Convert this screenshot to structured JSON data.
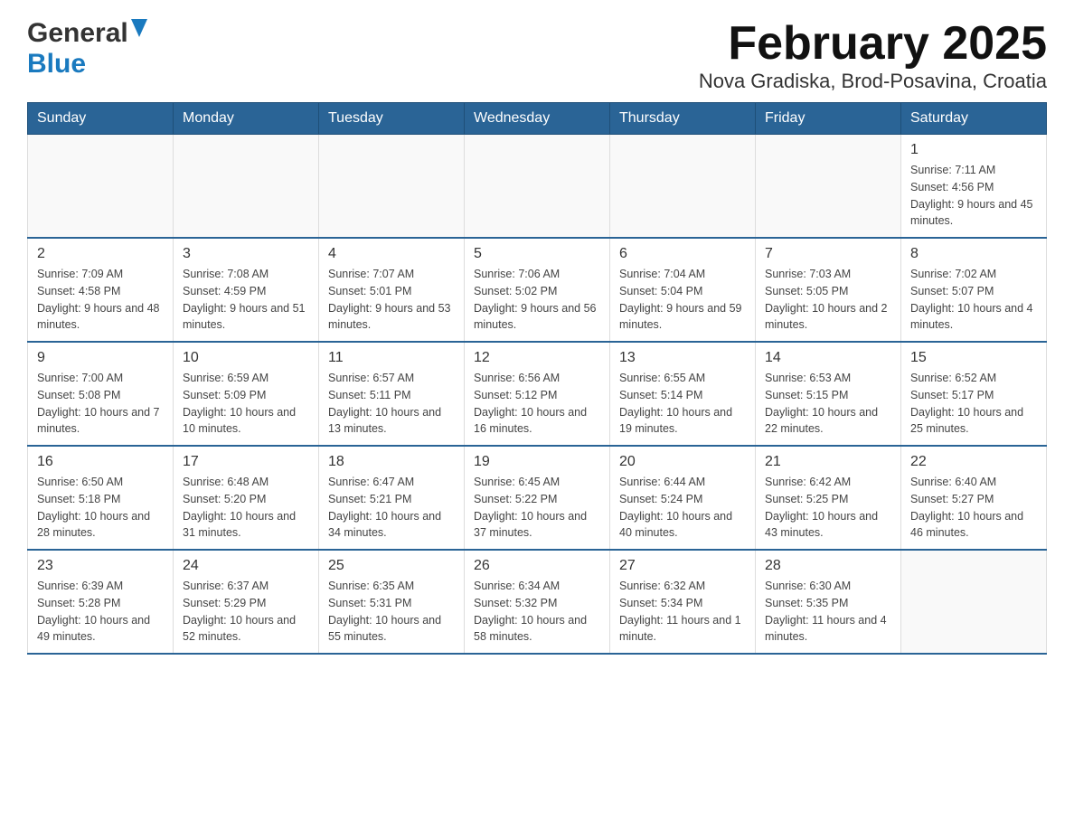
{
  "header": {
    "logo_general": "General",
    "logo_blue": "Blue",
    "title": "February 2025",
    "subtitle": "Nova Gradiska, Brod-Posavina, Croatia"
  },
  "days_of_week": [
    "Sunday",
    "Monday",
    "Tuesday",
    "Wednesday",
    "Thursday",
    "Friday",
    "Saturday"
  ],
  "weeks": [
    [
      {
        "day": "",
        "info": ""
      },
      {
        "day": "",
        "info": ""
      },
      {
        "day": "",
        "info": ""
      },
      {
        "day": "",
        "info": ""
      },
      {
        "day": "",
        "info": ""
      },
      {
        "day": "",
        "info": ""
      },
      {
        "day": "1",
        "info": "Sunrise: 7:11 AM\nSunset: 4:56 PM\nDaylight: 9 hours and 45 minutes."
      }
    ],
    [
      {
        "day": "2",
        "info": "Sunrise: 7:09 AM\nSunset: 4:58 PM\nDaylight: 9 hours and 48 minutes."
      },
      {
        "day": "3",
        "info": "Sunrise: 7:08 AM\nSunset: 4:59 PM\nDaylight: 9 hours and 51 minutes."
      },
      {
        "day": "4",
        "info": "Sunrise: 7:07 AM\nSunset: 5:01 PM\nDaylight: 9 hours and 53 minutes."
      },
      {
        "day": "5",
        "info": "Sunrise: 7:06 AM\nSunset: 5:02 PM\nDaylight: 9 hours and 56 minutes."
      },
      {
        "day": "6",
        "info": "Sunrise: 7:04 AM\nSunset: 5:04 PM\nDaylight: 9 hours and 59 minutes."
      },
      {
        "day": "7",
        "info": "Sunrise: 7:03 AM\nSunset: 5:05 PM\nDaylight: 10 hours and 2 minutes."
      },
      {
        "day": "8",
        "info": "Sunrise: 7:02 AM\nSunset: 5:07 PM\nDaylight: 10 hours and 4 minutes."
      }
    ],
    [
      {
        "day": "9",
        "info": "Sunrise: 7:00 AM\nSunset: 5:08 PM\nDaylight: 10 hours and 7 minutes."
      },
      {
        "day": "10",
        "info": "Sunrise: 6:59 AM\nSunset: 5:09 PM\nDaylight: 10 hours and 10 minutes."
      },
      {
        "day": "11",
        "info": "Sunrise: 6:57 AM\nSunset: 5:11 PM\nDaylight: 10 hours and 13 minutes."
      },
      {
        "day": "12",
        "info": "Sunrise: 6:56 AM\nSunset: 5:12 PM\nDaylight: 10 hours and 16 minutes."
      },
      {
        "day": "13",
        "info": "Sunrise: 6:55 AM\nSunset: 5:14 PM\nDaylight: 10 hours and 19 minutes."
      },
      {
        "day": "14",
        "info": "Sunrise: 6:53 AM\nSunset: 5:15 PM\nDaylight: 10 hours and 22 minutes."
      },
      {
        "day": "15",
        "info": "Sunrise: 6:52 AM\nSunset: 5:17 PM\nDaylight: 10 hours and 25 minutes."
      }
    ],
    [
      {
        "day": "16",
        "info": "Sunrise: 6:50 AM\nSunset: 5:18 PM\nDaylight: 10 hours and 28 minutes."
      },
      {
        "day": "17",
        "info": "Sunrise: 6:48 AM\nSunset: 5:20 PM\nDaylight: 10 hours and 31 minutes."
      },
      {
        "day": "18",
        "info": "Sunrise: 6:47 AM\nSunset: 5:21 PM\nDaylight: 10 hours and 34 minutes."
      },
      {
        "day": "19",
        "info": "Sunrise: 6:45 AM\nSunset: 5:22 PM\nDaylight: 10 hours and 37 minutes."
      },
      {
        "day": "20",
        "info": "Sunrise: 6:44 AM\nSunset: 5:24 PM\nDaylight: 10 hours and 40 minutes."
      },
      {
        "day": "21",
        "info": "Sunrise: 6:42 AM\nSunset: 5:25 PM\nDaylight: 10 hours and 43 minutes."
      },
      {
        "day": "22",
        "info": "Sunrise: 6:40 AM\nSunset: 5:27 PM\nDaylight: 10 hours and 46 minutes."
      }
    ],
    [
      {
        "day": "23",
        "info": "Sunrise: 6:39 AM\nSunset: 5:28 PM\nDaylight: 10 hours and 49 minutes."
      },
      {
        "day": "24",
        "info": "Sunrise: 6:37 AM\nSunset: 5:29 PM\nDaylight: 10 hours and 52 minutes."
      },
      {
        "day": "25",
        "info": "Sunrise: 6:35 AM\nSunset: 5:31 PM\nDaylight: 10 hours and 55 minutes."
      },
      {
        "day": "26",
        "info": "Sunrise: 6:34 AM\nSunset: 5:32 PM\nDaylight: 10 hours and 58 minutes."
      },
      {
        "day": "27",
        "info": "Sunrise: 6:32 AM\nSunset: 5:34 PM\nDaylight: 11 hours and 1 minute."
      },
      {
        "day": "28",
        "info": "Sunrise: 6:30 AM\nSunset: 5:35 PM\nDaylight: 11 hours and 4 minutes."
      },
      {
        "day": "",
        "info": ""
      }
    ]
  ]
}
